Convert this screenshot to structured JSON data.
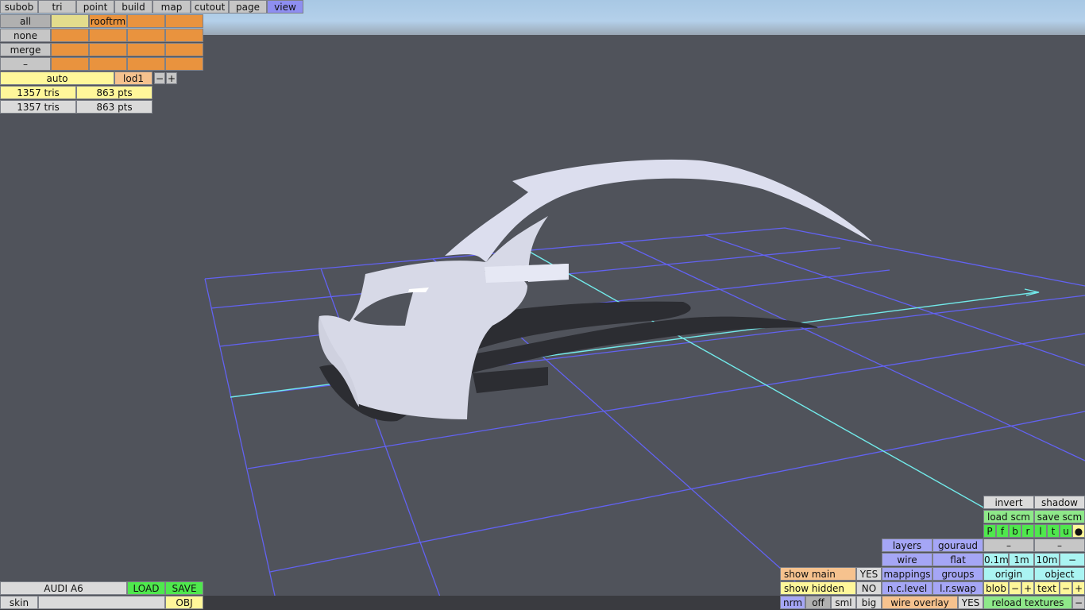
{
  "menu": {
    "tabs": [
      "subob",
      "tri",
      "point",
      "build",
      "map",
      "cutout",
      "page",
      "view"
    ],
    "active_tab": "view"
  },
  "subobjects": {
    "row_labels": [
      "all",
      "none",
      "merge",
      "–"
    ],
    "selected_name": "rooftrm"
  },
  "lod": {
    "auto_label": "auto",
    "lod_label": "lod1",
    "minus": "−",
    "plus": "+"
  },
  "stats": {
    "row1": {
      "tris": "1357 tris",
      "pts": "863 pts"
    },
    "row2": {
      "tris": "1357 tris",
      "pts": "863 pts"
    }
  },
  "file": {
    "name": "AUDI A6",
    "load": "LOAD",
    "save": "SAVE",
    "skin_label": "skin",
    "skin_value": "",
    "obj": "OBJ"
  },
  "right_panel": {
    "invert": "invert",
    "shadow": "shadow",
    "load_scm": "load scm",
    "save_scm": "save scm",
    "flags": [
      "P",
      "f",
      "b",
      "r",
      "l",
      "t",
      "u",
      "●"
    ],
    "layers": "layers",
    "gouraud": "gouraud",
    "dash": "–",
    "wire": "wire",
    "flat": "flat",
    "grid_01": "0.1m",
    "grid_1": "1m",
    "grid_10": "10m",
    "minus": "−",
    "show_main": "show main",
    "show_main_val": "YES",
    "mappings": "mappings",
    "groups": "groups",
    "origin": "origin",
    "object": "object",
    "show_hidden": "show hidden",
    "show_hidden_val": "NO",
    "nc_level": "n.c.level",
    "lr_swap": "l.r.swap",
    "blob": "blob",
    "text": "text",
    "plus": "+",
    "nrm": "nrm",
    "off": "off",
    "sml": "sml",
    "big": "big",
    "wire_overlay": "wire overlay",
    "wire_overlay_val": "YES",
    "reload_textures": "reload textures"
  },
  "colors": {
    "background": "#50535b",
    "grid": "#6060f0",
    "axis": "#70e8e8",
    "model": "#d6d8e6"
  }
}
